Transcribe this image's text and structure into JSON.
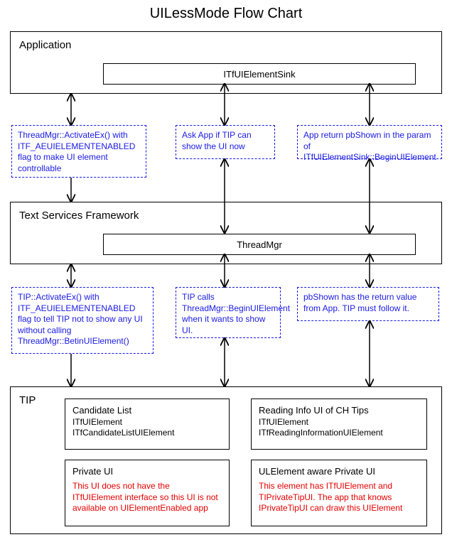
{
  "title": "UILessMode Flow Chart",
  "application": {
    "label": "Application",
    "inner": "ITfUIElementSink"
  },
  "dashed_top": {
    "left": "ThreadMgr::ActivateEx() with ITF_AEUIELEMENTENABLED flag to make UI element controllable",
    "mid": "Ask App if TIP can show the UI now",
    "right": "App return pbShown in the param of ITfUIElementSink::BeginUIElement"
  },
  "tsf": {
    "label": "Text Services Framework",
    "inner": "ThreadMgr"
  },
  "dashed_mid": {
    "left": "TIP::ActivateEx() with ITF_AEUIELEMENTENABLED flag to tell TIP not to show any UI without calling ThreadMgr::BetinUIElement()",
    "mid": "TIP calls ThreadMgr::BeginUIElement when it wants to show UI.",
    "right": "pbShown has the return value from App. TIP must follow it."
  },
  "tip": {
    "label": "TIP",
    "cards": {
      "candidate": {
        "title": "Candidate List",
        "sub1": "ITfUIElement",
        "sub2": "ITfCandidateListUIElement"
      },
      "reading": {
        "title": "Reading Info UI of CH Tips",
        "sub1": "ITfUIElement",
        "sub2": "ITfReadingInformationUIElement"
      },
      "private": {
        "title": "Private UI",
        "note": "This UI does not have the ITfUIElement interface so this UI is not available on UIElementEnabled app"
      },
      "aware": {
        "title": "ULElement aware Private UI",
        "note": "This element has ITfUIElement and TIPrivateTipUI. The app that knows IPrivateTipUI can draw this UIElement"
      }
    }
  }
}
